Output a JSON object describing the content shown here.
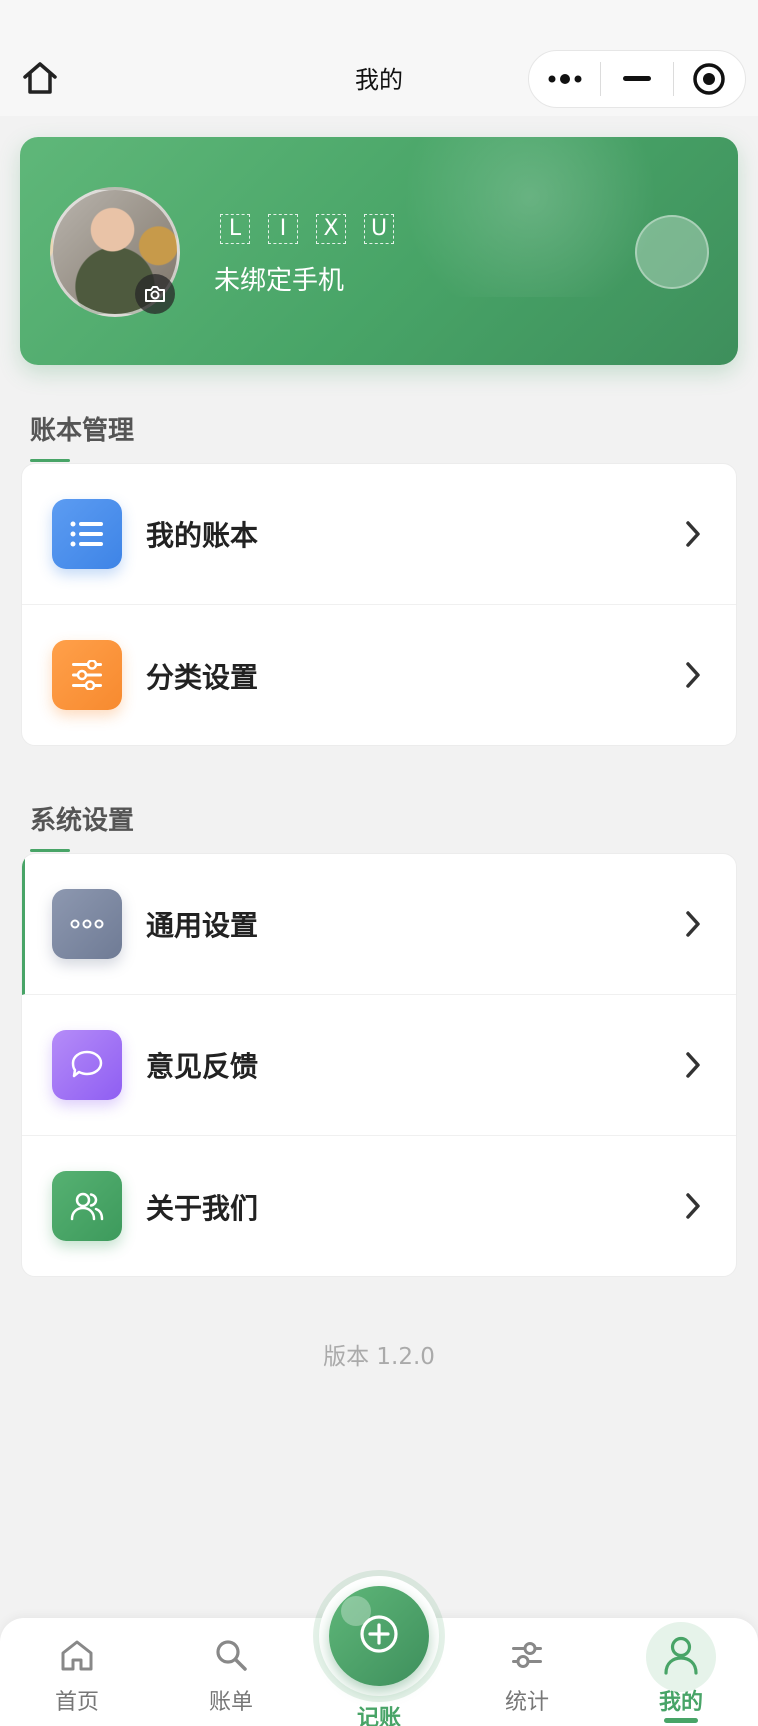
{
  "header": {
    "title": "我的",
    "home_icon": "home-icon",
    "capsule": [
      "more-dots-icon",
      "minimize-icon",
      "close-target-icon"
    ]
  },
  "profile": {
    "nickname_chars": [
      "L",
      "I",
      "X",
      "U"
    ],
    "phone_status": "未绑定手机"
  },
  "sections": [
    {
      "title": "账本管理",
      "items": [
        {
          "label": "我的账本",
          "icon": "list-icon",
          "color": "#4a8ff0"
        },
        {
          "label": "分类设置",
          "icon": "sliders-icon",
          "color": "#f89238"
        }
      ]
    },
    {
      "title": "系统设置",
      "items": [
        {
          "label": "通用设置",
          "icon": "more-icon",
          "color": "#7d88a2"
        },
        {
          "label": "意见反馈",
          "icon": "message-icon",
          "color": "#9d6ef5"
        },
        {
          "label": "关于我们",
          "icon": "users-icon",
          "color": "#48a467"
        }
      ]
    }
  ],
  "version": "版本 1.2.0",
  "tabbar": {
    "tabs": [
      {
        "label": "首页",
        "icon": "home-icon"
      },
      {
        "label": "账单",
        "icon": "search-icon"
      },
      {
        "label": "记账",
        "icon": "add-circle-icon"
      },
      {
        "label": "统计",
        "icon": "sliders-icon"
      },
      {
        "label": "我的",
        "icon": "user-icon"
      }
    ],
    "active_index": 4
  },
  "colors": {
    "accent": "#48a467",
    "background": "#f2f2f2"
  }
}
